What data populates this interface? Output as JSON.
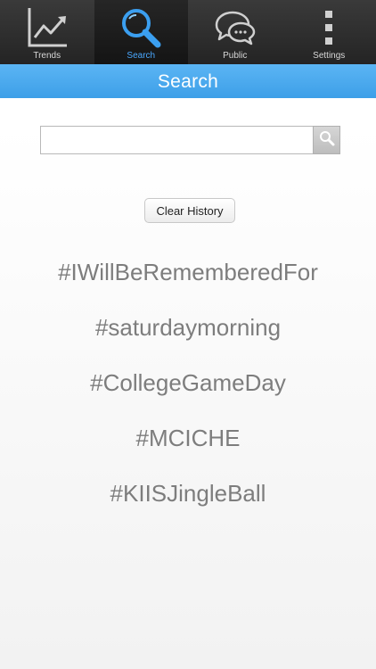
{
  "tabs": [
    {
      "label": "Trends",
      "icon": "trend-chart-icon",
      "active": false
    },
    {
      "label": "Search",
      "icon": "magnifier-icon",
      "active": true
    },
    {
      "label": "Public",
      "icon": "chat-bubbles-icon",
      "active": false
    },
    {
      "label": "Settings",
      "icon": "vertical-dots-icon",
      "active": false
    }
  ],
  "header": {
    "title": "Search"
  },
  "search": {
    "value": "",
    "placeholder": ""
  },
  "clear_history_label": "Clear History",
  "history": [
    "#IWillBeRememberedFor",
    "#saturdaymorning",
    "#CollegeGameDay",
    "#MCICHE",
    "#KIISJingleBall"
  ],
  "colors": {
    "accent": "#4aa8ff",
    "header_blue": "#4aa9ee",
    "tabbar": "#2c2c2c",
    "history_text": "#7d7d7d"
  }
}
